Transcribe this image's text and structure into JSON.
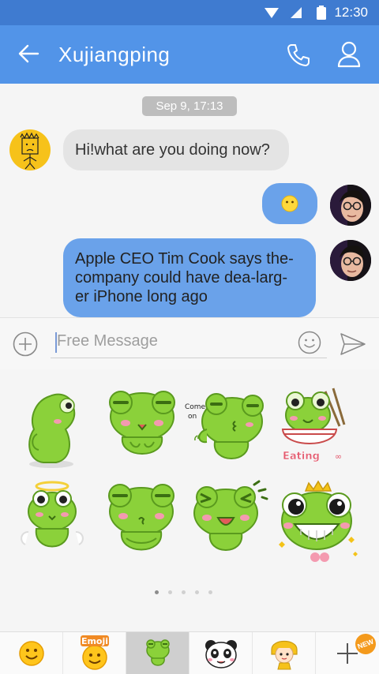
{
  "status_bar": {
    "time": "12:30"
  },
  "header": {
    "title": "Xujiangping"
  },
  "conversation": {
    "date_chip": "Sep 9, 17:13",
    "messages": [
      {
        "direction": "incoming",
        "text": "Hi!what are you doing now?"
      },
      {
        "direction": "outgoing",
        "text": "😶",
        "emoji": "neutral-face"
      },
      {
        "direction": "outgoing",
        "lines": [
          "Apple CEO Tim Cook says the-",
          "company could have dea-larg-",
          "er iPhone long ago"
        ]
      }
    ]
  },
  "composer": {
    "placeholder": "Free Message"
  },
  "stickers": {
    "captions": {
      "come_on_line1": "Come",
      "come_on_line2": "on",
      "eating": "Eating"
    },
    "page_count": 5,
    "active_page": 1
  },
  "tabs": [
    {
      "name": "smiley",
      "selected": false
    },
    {
      "name": "emoji",
      "label": "Emoji",
      "selected": false
    },
    {
      "name": "frog-stickers",
      "selected": true
    },
    {
      "name": "panda-stickers",
      "selected": false
    },
    {
      "name": "girl-stickers",
      "selected": false
    },
    {
      "name": "add-more",
      "badge": "NEW",
      "selected": false
    }
  ],
  "colors": {
    "status_bar": "#3f7bd0",
    "app_bar": "#5294e8",
    "outgoing_bubble": "#6aa2ea",
    "incoming_bubble": "#e4e4e4",
    "frog_green": "#8bd13a"
  }
}
